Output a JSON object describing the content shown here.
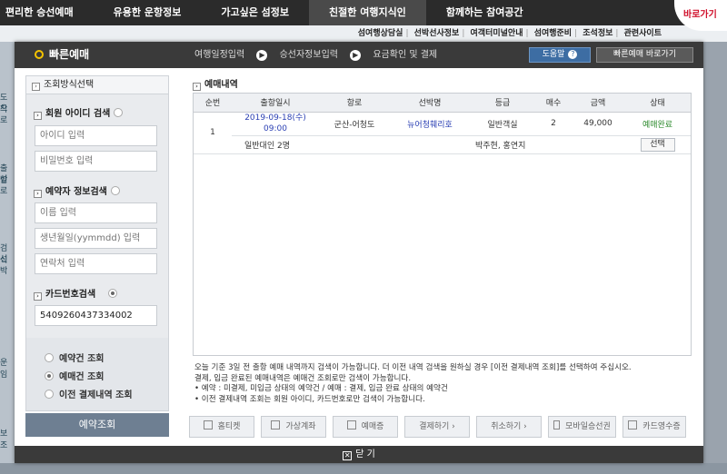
{
  "topnav": [
    "편리한 승선예매",
    "유용한 운항정보",
    "가고싶은 섬정보",
    "친절한 여행지식인",
    "함께하는 참여공간"
  ],
  "subnav": [
    "섬여행상담실",
    "선박선사정보",
    "여객터미널안내",
    "섬여행준비",
    "조석정보",
    "관련사이트"
  ],
  "barogagi": "바로가기",
  "left_bg_labels": [
    "도착",
    "으로",
    "출발",
    "선로",
    "검식",
    "선박",
    "운임",
    "보조"
  ],
  "modal": {
    "title": "빠른예매",
    "steps": [
      "여행일정입력",
      "승선자정보입력",
      "요금확인 및 결제"
    ],
    "help_label": "도움말",
    "shortcut_label": "빠른예매 바로가기",
    "close_label": "닫 기"
  },
  "search": {
    "heading": "조회방식선택",
    "member_label": "회원 아이디 검색",
    "id_placeholder": "아이디 입력",
    "pw_placeholder": "비밀번호 입력",
    "reserver_label": "예약자 정보검색",
    "name_placeholder": "이름 입력",
    "birth_placeholder": "생년월일(yymmdd) 입력",
    "phone_placeholder": "연락처 입력",
    "card_label": "카드번호검색",
    "card_value": "5409260437334002",
    "types": [
      "예약건 조회",
      "예매건 조회",
      "이전 결제내역 조회"
    ],
    "selected_type": 1,
    "button": "예약조회"
  },
  "result": {
    "heading": "예매내역",
    "columns": [
      "순번",
      "출항일시",
      "항로",
      "선박명",
      "등급",
      "매수",
      "금액",
      "상태"
    ],
    "rows": [
      {
        "no": "1",
        "date": "2019-09-18(수)",
        "time": "09:00",
        "route": "군산-어청도",
        "ship": "뉴어청훼리호",
        "grade": "일반객실",
        "count": "2",
        "amount": "49,000",
        "status": "예매완료",
        "detail_people": "일반대인 2명",
        "detail_names": "박주현, 홍연지",
        "select_label": "선택"
      }
    ]
  },
  "notice": [
    "오늘 기준 3일 전 출항 예매 내역까지 검색이 가능합니다. 더 이전 내역 검색을 원하실 경우 [이전 결제내역 조회]를 선택하여 주십시오.",
    "결제, 입금 완료된 예매내역은 예매건 조회로만 검색이 가능합니다.",
    "• 예약 : 미결제, 미입금 상태의 예약건 / 예매 : 결제, 입금 완료 상태의 예약건",
    "• 이전 결제내역 조회는 회원 아이디, 카드번호로만 검색이 가능합니다."
  ],
  "actions": [
    "홈티켓",
    "가상계좌",
    "예매증",
    "결제하기 ›",
    "취소하기 ›",
    "모바일승선권",
    "카드영수증"
  ]
}
